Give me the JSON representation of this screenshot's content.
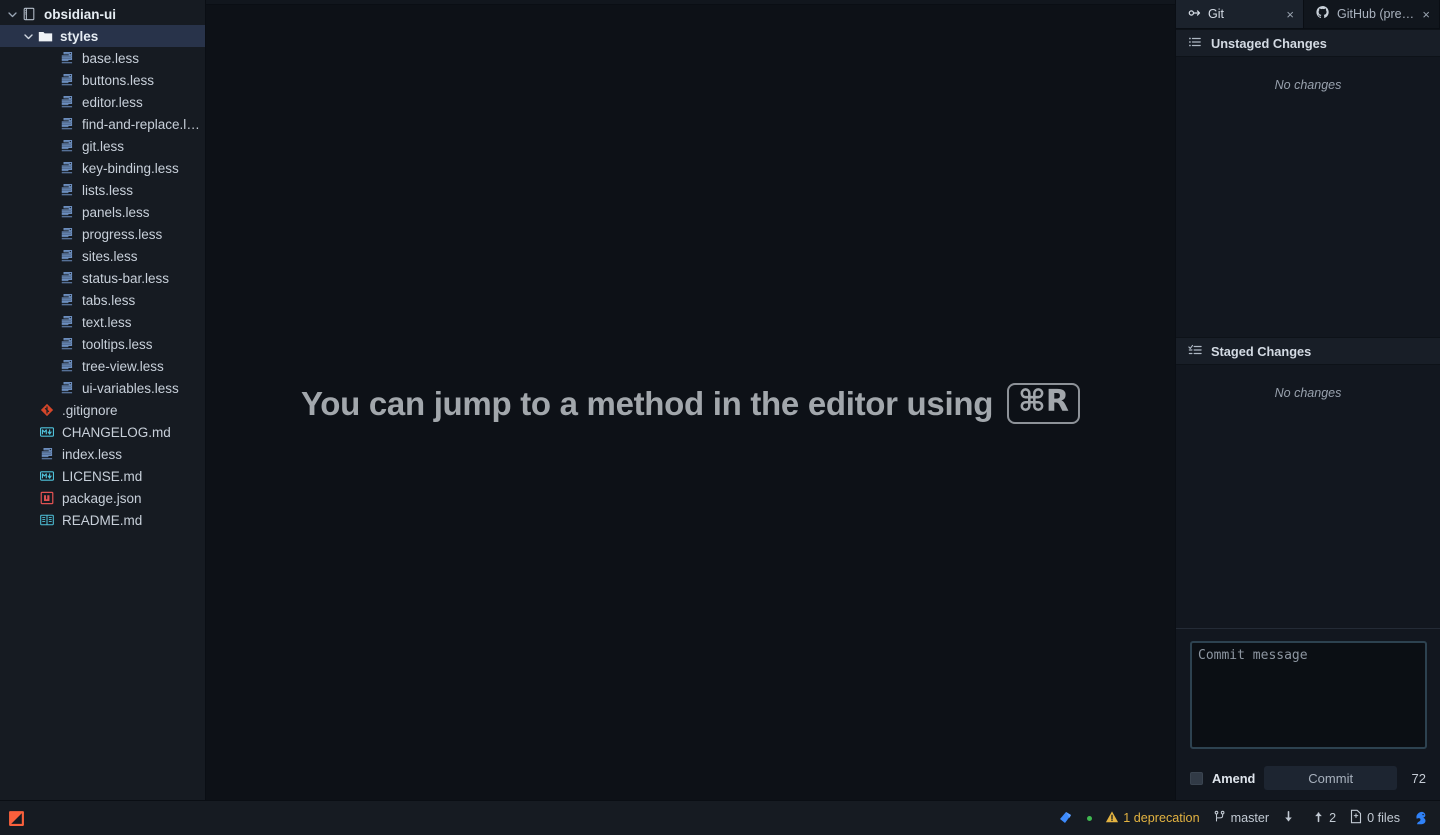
{
  "tree": {
    "root": {
      "label": "obsidian-ui",
      "icon": "repo-icon",
      "expanded": true
    },
    "folder": {
      "label": "styles",
      "icon": "folder-icon",
      "expanded": true,
      "selected": true
    },
    "style_files": [
      {
        "label": "base.less",
        "icon": "less-icon"
      },
      {
        "label": "buttons.less",
        "icon": "less-icon"
      },
      {
        "label": "editor.less",
        "icon": "less-icon"
      },
      {
        "label": "find-and-replace.less",
        "icon": "less-icon"
      },
      {
        "label": "git.less",
        "icon": "less-icon"
      },
      {
        "label": "key-binding.less",
        "icon": "less-icon"
      },
      {
        "label": "lists.less",
        "icon": "less-icon"
      },
      {
        "label": "panels.less",
        "icon": "less-icon"
      },
      {
        "label": "progress.less",
        "icon": "less-icon"
      },
      {
        "label": "sites.less",
        "icon": "less-icon"
      },
      {
        "label": "status-bar.less",
        "icon": "less-icon"
      },
      {
        "label": "tabs.less",
        "icon": "less-icon"
      },
      {
        "label": "text.less",
        "icon": "less-icon"
      },
      {
        "label": "tooltips.less",
        "icon": "less-icon"
      },
      {
        "label": "tree-view.less",
        "icon": "less-icon"
      },
      {
        "label": "ui-variables.less",
        "icon": "less-icon"
      }
    ],
    "root_files": [
      {
        "label": ".gitignore",
        "icon": "git-icon"
      },
      {
        "label": "CHANGELOG.md",
        "icon": "markdown-icon"
      },
      {
        "label": "index.less",
        "icon": "less-icon"
      },
      {
        "label": "LICENSE.md",
        "icon": "markdown-icon"
      },
      {
        "label": "package.json",
        "icon": "npm-icon"
      },
      {
        "label": "README.md",
        "icon": "book-icon"
      }
    ]
  },
  "editor": {
    "tip_text": "You can jump to a method in the editor using",
    "tip_key": "⌘R"
  },
  "dock": {
    "tabs": [
      {
        "label": "Git",
        "icon": "git-branch-icon",
        "active": true,
        "close": "×"
      },
      {
        "label": "GitHub (pre…",
        "icon": "github-icon",
        "active": false,
        "close": "×"
      }
    ],
    "unstaged": {
      "header": "Unstaged Changes",
      "icon": "list-icon",
      "empty": "No changes"
    },
    "staged": {
      "header": "Staged Changes",
      "icon": "check-list-icon",
      "empty": "No changes"
    },
    "commit": {
      "placeholder": "Commit message",
      "value": "",
      "amend_label": "Amend",
      "amend_checked": false,
      "button_label": "Commit",
      "char_count": "72"
    }
  },
  "status_bar": {
    "left": [
      {
        "name": "atom-launch-icon",
        "icon": "atom-red-icon"
      }
    ],
    "right": [
      {
        "name": "teletype-icon",
        "icon": "teletype-icon"
      },
      {
        "name": "linter-dot",
        "icon": "green-dot"
      },
      {
        "name": "deprecation-warning",
        "icon": "warning-icon",
        "label": "1 deprecation"
      },
      {
        "name": "git-branch",
        "icon": "branch-icon",
        "label": "master"
      },
      {
        "name": "pull-count",
        "icon": "arrow-down-icon",
        "label": ""
      },
      {
        "name": "push-count",
        "icon": "arrow-up-icon",
        "label": "2"
      },
      {
        "name": "changed-files",
        "icon": "diff-file-icon",
        "label": "0 files"
      },
      {
        "name": "github-squirrel",
        "icon": "squirrel-icon",
        "label": ""
      }
    ]
  },
  "colors": {
    "bg_editor": "#0d1117",
    "bg_panel": "#161b22",
    "selection": "#28334a",
    "accent_warn": "#e3b341",
    "accent_green": "#3fb950",
    "accent_blue": "#2f81f7",
    "less_icon": "#6c8ebf",
    "markdown_icon": "#4fc1d9",
    "npm_icon": "#e05252",
    "git_icon": "#d4462a"
  }
}
